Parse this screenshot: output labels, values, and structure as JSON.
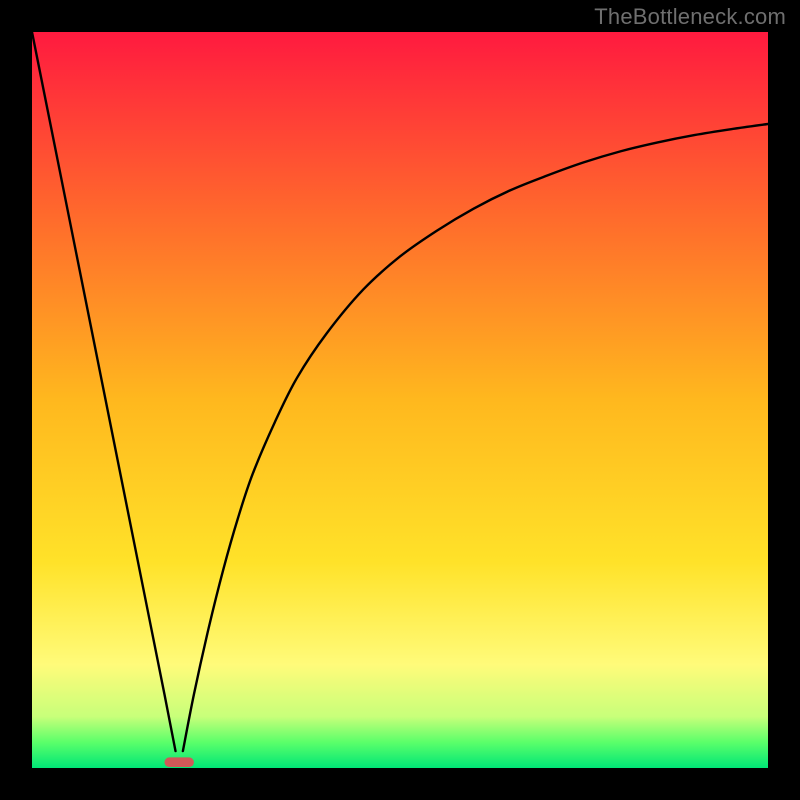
{
  "watermark": "TheBottleneck.com",
  "chart_data": {
    "type": "line",
    "title": "",
    "xlabel": "",
    "ylabel": "",
    "xlim": [
      0,
      100
    ],
    "ylim": [
      0,
      100
    ],
    "x_at_minimum": 20,
    "marker": {
      "x_center": 20,
      "y": 0,
      "width_pct": 4,
      "height_pct": 1.3,
      "color": "#d15858"
    },
    "gradient_stops": [
      {
        "pos": 0.0,
        "color": "#ff1a3f"
      },
      {
        "pos": 0.25,
        "color": "#ff6a2c"
      },
      {
        "pos": 0.5,
        "color": "#ffb81e"
      },
      {
        "pos": 0.72,
        "color": "#ffe229"
      },
      {
        "pos": 0.86,
        "color": "#fffb7a"
      },
      {
        "pos": 0.93,
        "color": "#c8ff7a"
      },
      {
        "pos": 0.965,
        "color": "#5bff6a"
      },
      {
        "pos": 1.0,
        "color": "#00e676"
      }
    ],
    "series": [
      {
        "name": "left-branch",
        "x": [
          0,
          2,
          4,
          6,
          8,
          10,
          12,
          14,
          16,
          18,
          19.5
        ],
        "y": [
          100,
          90,
          80,
          70,
          60,
          50,
          40,
          30,
          20,
          10,
          2.3
        ]
      },
      {
        "name": "right-branch",
        "x": [
          20.5,
          22,
          24,
          26,
          28,
          30,
          33,
          36,
          40,
          45,
          50,
          55,
          60,
          65,
          70,
          75,
          80,
          85,
          90,
          95,
          100
        ],
        "y": [
          2.3,
          10,
          19,
          27,
          34,
          40,
          47,
          53,
          59,
          65,
          69.5,
          73,
          76,
          78.5,
          80.5,
          82.3,
          83.8,
          85,
          86,
          86.8,
          87.5
        ]
      }
    ]
  }
}
